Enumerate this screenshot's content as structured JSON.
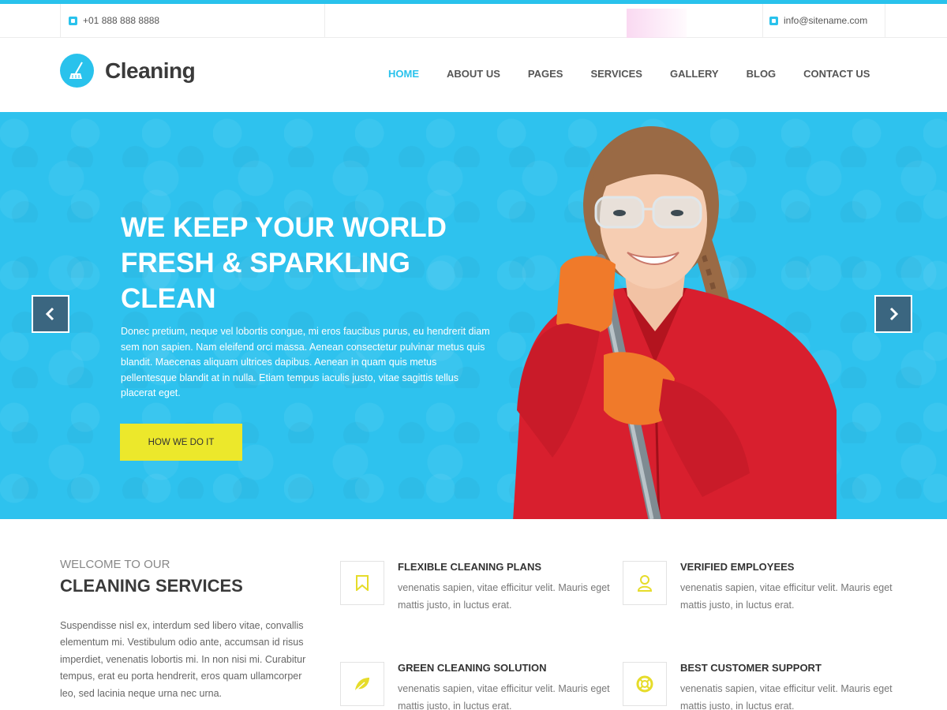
{
  "topbar": {
    "phone": "+01 888 888 8888",
    "email": "info@sitename.com"
  },
  "header": {
    "logo_text": "Cleaning",
    "nav": [
      "HOME",
      "ABOUT US",
      "PAGES",
      "SERVICES",
      "GALLERY",
      "BLOG",
      "CONTACT US"
    ],
    "active_nav": "HOME"
  },
  "hero": {
    "title": "WE KEEP YOUR WORLD FRESH & SPARKLING CLEAN",
    "text": "Donec pretium, neque vel lobortis congue, mi eros faucibus purus, eu hendrerit diam sem non sapien. Nam eleifend orci massa. Aenean consectetur pulvinar metus quis blandit. Maecenas aliquam ultrices dapibus. Aenean in quam quis metus pellentesque blandit at in nulla. Etiam tempus iaculis justo, vitae sagittis tellus placerat eget.",
    "button": "HOW WE DO IT"
  },
  "welcome": {
    "subtitle": "WELCOME TO OUR",
    "title": "CLEANING SERVICES",
    "text": "Suspendisse nisl ex, interdum sed libero vitae, convallis elementum mi. Vestibulum odio ante, accumsan id risus imperdiet, venenatis lobortis mi. In non nisi mi. Curabitur tempus, erat eu porta hendrerit, eros quam ullamcorper leo, sed lacinia neque urna nec urna."
  },
  "features": [
    {
      "title": "FLEXIBLE CLEANING PLANS",
      "text": "venenatis sapien, vitae efficitur velit. Mauris eget mattis justo, in luctus erat.",
      "icon": "bookmark-icon"
    },
    {
      "title": "VERIFIED EMPLOYEES",
      "text": "venenatis sapien, vitae efficitur velit. Mauris eget mattis justo, in luctus erat.",
      "icon": "user-icon"
    },
    {
      "title": "GREEN CLEANING SOLUTION",
      "text": "venenatis sapien, vitae efficitur velit. Mauris eget mattis justo, in luctus erat.",
      "icon": "leaf-icon"
    },
    {
      "title": "BEST CUSTOMER SUPPORT",
      "text": "venenatis sapien, vitae efficitur velit. Mauris eget mattis justo, in luctus erat.",
      "icon": "lifebuoy-icon"
    }
  ],
  "colors": {
    "accent": "#29c2ec",
    "hero_bg": "#2ec2ee",
    "button": "#ece82b",
    "icon_yellow": "#e6dc2a",
    "arrow_bg": "#3b6680"
  }
}
